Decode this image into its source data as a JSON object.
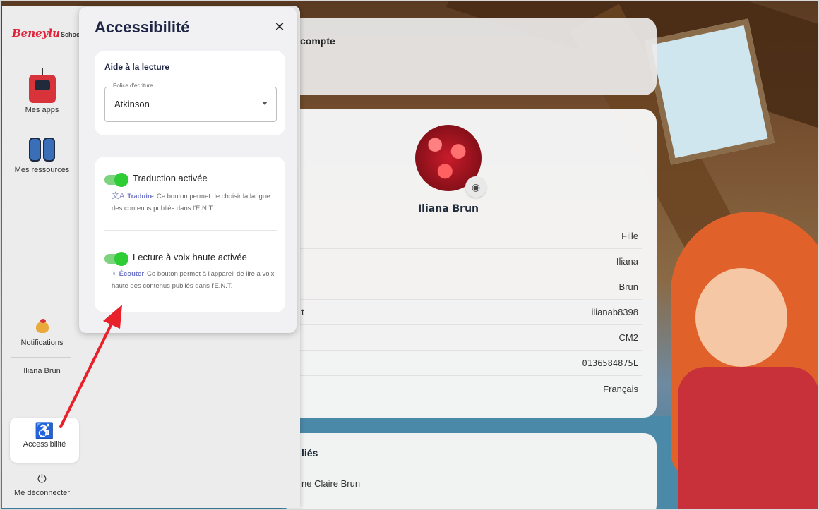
{
  "sidebar": {
    "logo_main": "Beneylu",
    "logo_sub": "School",
    "items": [
      {
        "label": "Mes apps",
        "icon": "robot-icon"
      },
      {
        "label": "Mes ressources",
        "icon": "binoculars-icon"
      },
      {
        "label": "Notifications",
        "icon": "rooster-icon"
      },
      {
        "label": "Iliana Brun",
        "icon": "avatar"
      },
      {
        "label": "Accessibilité",
        "icon": "accessibility-icon"
      },
      {
        "label": "Me déconnecter",
        "icon": "power-icon"
      }
    ]
  },
  "accessibility_panel": {
    "title": "Accessibilité",
    "close_label": "✕",
    "reading_section": {
      "title": "Aide à la lecture",
      "font_field_label": "Police d'écriture",
      "font_value": "Atkinson"
    },
    "translation": {
      "label": "Traduction activée",
      "enabled": true,
      "link": "Traduire",
      "description": "Ce bouton permet de choisir la langue des contenus publiés dans l'E.N.T."
    },
    "tts": {
      "label": "Lecture à voix haute activée",
      "enabled": true,
      "link": "Écouter",
      "description": "Ce bouton permet à l'appareil de lire à voix haute des contenus publiés dans l'E.N.T."
    }
  },
  "profile": {
    "top_card_title": "compte",
    "name": "Iliana Brun",
    "rows": [
      {
        "key": "",
        "value": "Fille"
      },
      {
        "key": "",
        "value": "Iliana"
      },
      {
        "key": "",
        "value": "Brun"
      },
      {
        "key": "t",
        "value": "ilianab8398"
      },
      {
        "key": "",
        "value": "CM2"
      },
      {
        "key": "",
        "value": "0136584875L"
      },
      {
        "key": "",
        "value": "Français"
      }
    ],
    "links_title": "liés",
    "links_item": "ne Claire Brun"
  },
  "colors": {
    "toggle_on": "#2ecc35",
    "link": "#6f76c8",
    "title": "#1f2545",
    "arrow": "#e8202a"
  }
}
